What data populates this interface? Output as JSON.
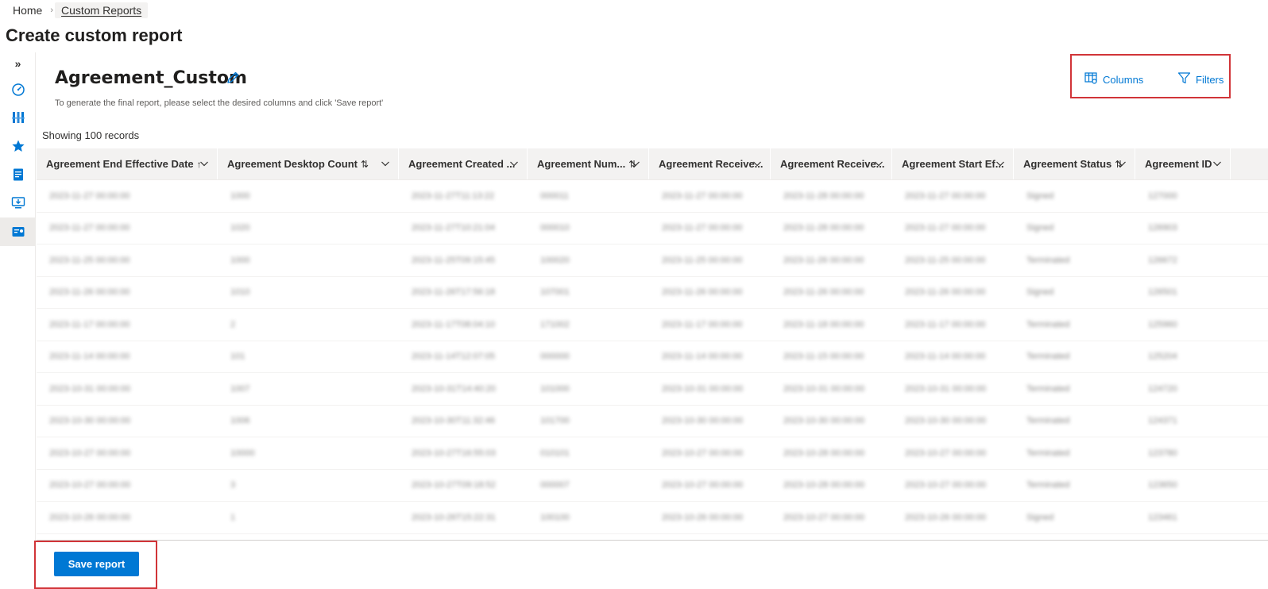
{
  "breadcrumb": {
    "home": "Home",
    "current": "Custom Reports"
  },
  "page_title": "Create custom report",
  "siderail": {
    "expand_label": "»",
    "icons": [
      "dashboard-icon",
      "columns-icon",
      "favorites-icon",
      "report-icon",
      "download-monitor-icon",
      "custom-report-icon"
    ]
  },
  "report": {
    "name": "Agreement_Custom",
    "subtitle": "To generate the final report, please select the desired columns and click 'Save report'"
  },
  "toolbar": {
    "columns_label": "Columns",
    "filters_label": "Filters"
  },
  "records_label": "Showing 100 records",
  "table": {
    "columns": [
      {
        "label": "Agreement End Effective Date",
        "sort": "↑"
      },
      {
        "label": "Agreement Desktop Count",
        "sort": "⇅"
      },
      {
        "label": "Agreement Created ...",
        "sort": ""
      },
      {
        "label": "Agreement Num...",
        "sort": "⇅"
      },
      {
        "label": "Agreement Receive...",
        "sort": ""
      },
      {
        "label": "Agreement Receive...",
        "sort": ""
      },
      {
        "label": "Agreement Start Ef...",
        "sort": ""
      },
      {
        "label": "Agreement Status",
        "sort": "⇅"
      },
      {
        "label": "Agreement ID",
        "sort": ""
      }
    ],
    "rows": [
      [
        "2023-11-27 00:00:00",
        "1000",
        "2023-11-27T11:13:22",
        "000011",
        "2023-11-27 00:00:00",
        "2023-11-28 00:00:00",
        "2023-11-27 00:00:00",
        "Signed",
        "127000"
      ],
      [
        "2023-11-27 00:00:00",
        "1020",
        "2023-11-27T10:21:04",
        "000010",
        "2023-11-27 00:00:00",
        "2023-11-28 00:00:00",
        "2023-11-27 00:00:00",
        "Signed",
        "126903"
      ],
      [
        "2023-11-25 00:00:00",
        "1000",
        "2023-11-25T09:15:45",
        "100020",
        "2023-11-25 00:00:00",
        "2023-11-26 00:00:00",
        "2023-11-25 00:00:00",
        "Terminated",
        "126672"
      ],
      [
        "2023-11-26 00:00:00",
        "1010",
        "2023-11-26T17:56:18",
        "107001",
        "2023-11-26 00:00:00",
        "2023-11-26 00:00:00",
        "2023-11-26 00:00:00",
        "Signed",
        "126501"
      ],
      [
        "2023-11-17 00:00:00",
        "2",
        "2023-11-17T08:04:10",
        "171002",
        "2023-11-17 00:00:00",
        "2023-11-18 00:00:00",
        "2023-11-17 00:00:00",
        "Terminated",
        "125960"
      ],
      [
        "2023-11-14 00:00:00",
        "101",
        "2023-11-14T12:07:05",
        "000000",
        "2023-11-14 00:00:00",
        "2023-11-15 00:00:00",
        "2023-11-14 00:00:00",
        "Terminated",
        "125204"
      ],
      [
        "2023-10-31 00:00:00",
        "1007",
        "2023-10-31T14:40:20",
        "101000",
        "2023-10-31 00:00:00",
        "2023-10-31 00:00:00",
        "2023-10-31 00:00:00",
        "Terminated",
        "124720"
      ],
      [
        "2023-10-30 00:00:00",
        "1006",
        "2023-10-30T11:32:46",
        "101700",
        "2023-10-30 00:00:00",
        "2023-10-30 00:00:00",
        "2023-10-30 00:00:00",
        "Terminated",
        "124371"
      ],
      [
        "2023-10-27 00:00:00",
        "10000",
        "2023-10-27T16:55:03",
        "010101",
        "2023-10-27 00:00:00",
        "2023-10-28 00:00:00",
        "2023-10-27 00:00:00",
        "Terminated",
        "123780"
      ],
      [
        "2023-10-27 00:00:00",
        "3",
        "2023-10-27T09:18:52",
        "000007",
        "2023-10-27 00:00:00",
        "2023-10-28 00:00:00",
        "2023-10-27 00:00:00",
        "Terminated",
        "123650"
      ],
      [
        "2023-10-26 00:00:00",
        "1",
        "2023-10-26T15:22:31",
        "100100",
        "2023-10-26 00:00:00",
        "2023-10-27 00:00:00",
        "2023-10-26 00:00:00",
        "Signed",
        "123461"
      ]
    ]
  },
  "save_button_label": "Save report",
  "colors": {
    "accent": "#0078d4",
    "highlight": "#d13438"
  }
}
